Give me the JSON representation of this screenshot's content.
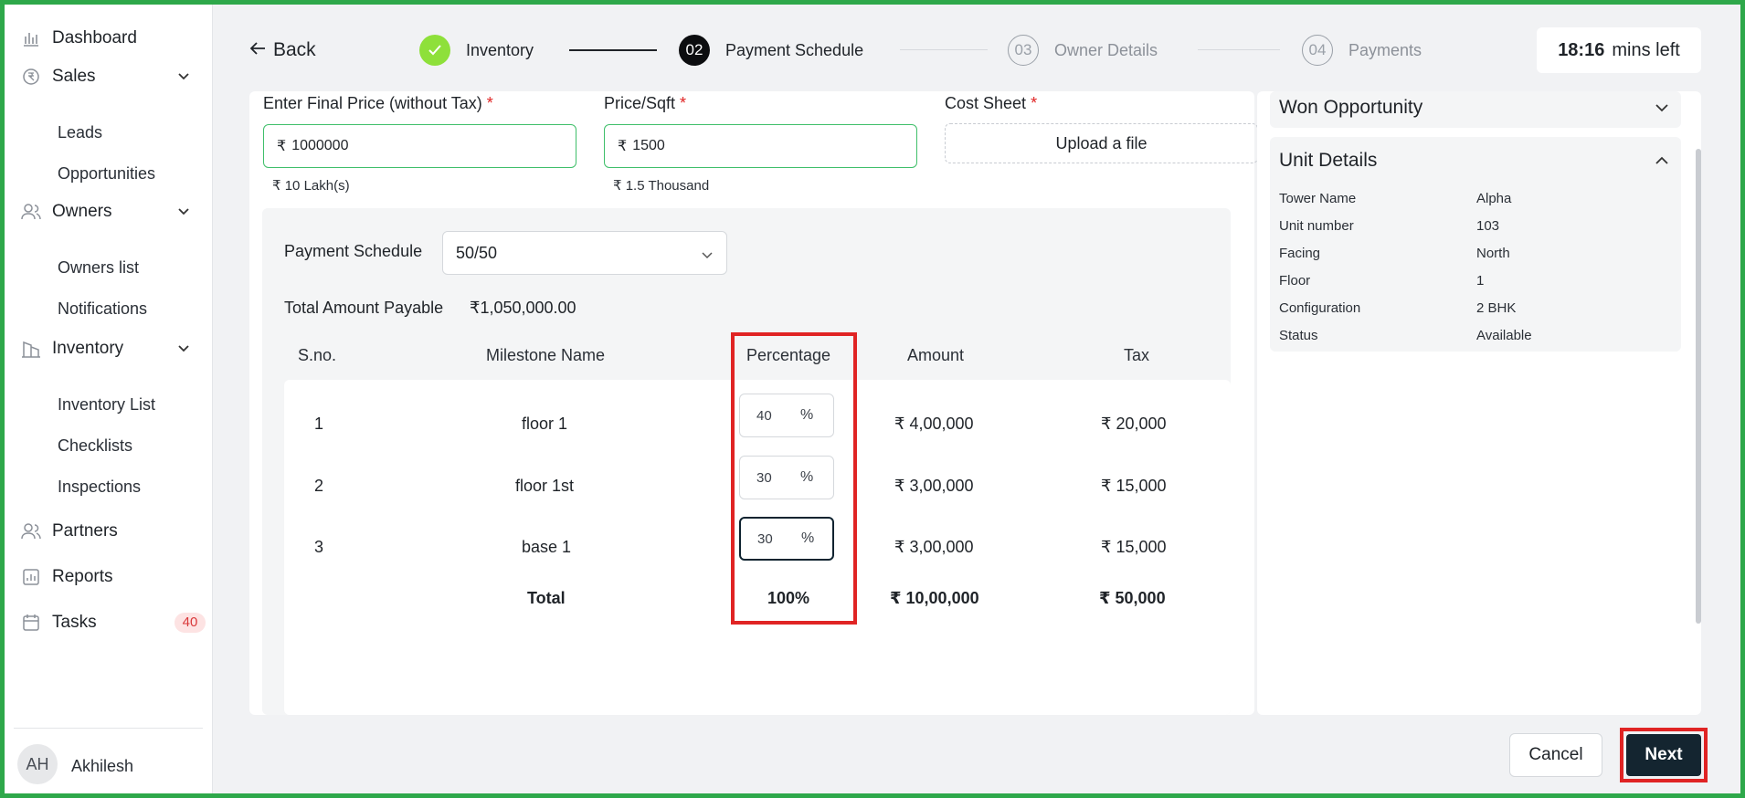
{
  "sidebar": {
    "items": [
      {
        "label": "Dashboard"
      },
      {
        "label": "Sales"
      },
      {
        "label": "Leads"
      },
      {
        "label": "Opportunities"
      },
      {
        "label": "Owners"
      },
      {
        "label": "Owners list"
      },
      {
        "label": "Notifications"
      },
      {
        "label": "Inventory"
      },
      {
        "label": "Inventory List"
      },
      {
        "label": "Checklists"
      },
      {
        "label": "Inspections"
      },
      {
        "label": "Partners"
      },
      {
        "label": "Reports"
      },
      {
        "label": "Tasks",
        "badge": "40"
      }
    ],
    "user": {
      "initials": "AH",
      "name": "Akhilesh"
    }
  },
  "header": {
    "back_label": "Back",
    "steps": [
      {
        "number": "",
        "label": "Inventory",
        "state": "done"
      },
      {
        "number": "02",
        "label": "Payment Schedule",
        "state": "active"
      },
      {
        "number": "03",
        "label": "Owner Details",
        "state": "todo"
      },
      {
        "number": "04",
        "label": "Payments",
        "state": "todo"
      }
    ],
    "timer": {
      "value": "18:16",
      "suffix": "mins left"
    }
  },
  "form": {
    "final_price": {
      "label": "Enter Final Price (without Tax)",
      "currency": "₹",
      "value": "1000000",
      "helper": "₹ 10 Lakh(s)"
    },
    "price_sqft": {
      "label": "Price/Sqft",
      "currency": "₹",
      "value": "1500",
      "helper": "₹ 1.5 Thousand"
    },
    "cost_sheet": {
      "label": "Cost Sheet",
      "button": "Upload a file"
    },
    "required_mark": "*"
  },
  "schedule": {
    "label": "Payment Schedule",
    "selected": "50/50",
    "total_label": "Total Amount Payable",
    "total_value": "₹1,050,000.00",
    "columns": [
      "S.no.",
      "Milestone Name",
      "Percentage",
      "Amount",
      "Tax"
    ],
    "rows": [
      {
        "sno": "1",
        "name": "floor 1",
        "percent": "40",
        "unit": "%",
        "amount": "₹ 4,00,000",
        "tax": "₹ 20,000"
      },
      {
        "sno": "2",
        "name": "floor 1st",
        "percent": "30",
        "unit": "%",
        "amount": "₹ 3,00,000",
        "tax": "₹ 15,000"
      },
      {
        "sno": "3",
        "name": "base 1",
        "percent": "30",
        "unit": "%",
        "amount": "₹ 3,00,000",
        "tax": "₹ 15,000"
      }
    ],
    "total_row": {
      "label": "Total",
      "percent": "100%",
      "amount": "₹ 10,00,000",
      "tax": "₹ 50,000"
    }
  },
  "right_panel": {
    "won_opportunity": "Won Opportunity",
    "unit_details": {
      "title": "Unit Details",
      "fields": [
        {
          "key": "Tower Name",
          "value": "Alpha"
        },
        {
          "key": "Unit number",
          "value": "103"
        },
        {
          "key": "Facing",
          "value": "North"
        },
        {
          "key": "Floor",
          "value": "1"
        },
        {
          "key": "Configuration",
          "value": "2 BHK"
        },
        {
          "key": "Status",
          "value": "Available"
        }
      ]
    }
  },
  "footer": {
    "cancel_label": "Cancel",
    "next_label": "Next"
  },
  "colors": {
    "accent_green": "#3fbf6a",
    "step_done": "#8ee03a",
    "highlight_red": "#e02424",
    "primary_dark": "#142530"
  }
}
